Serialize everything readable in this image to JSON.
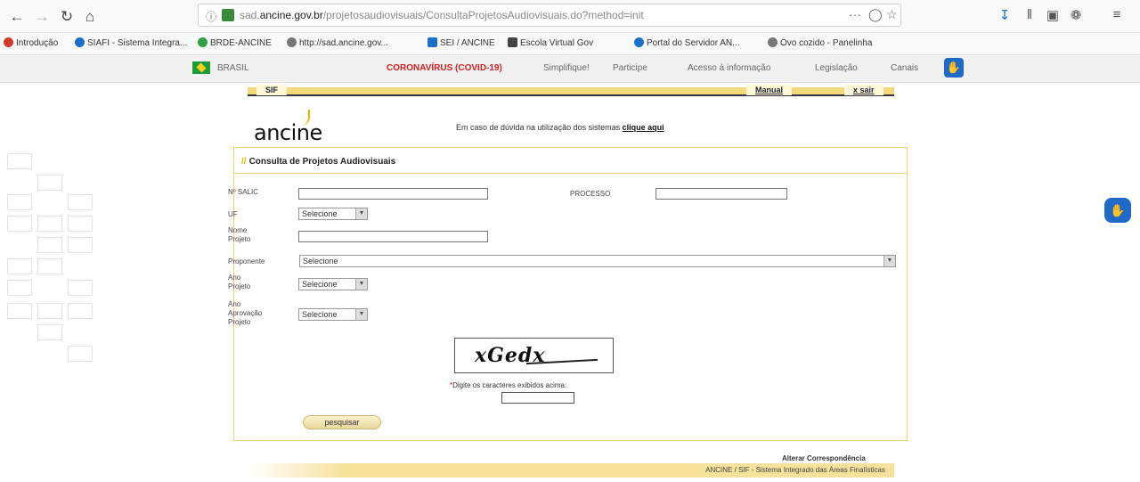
{
  "browser": {
    "url_prefix": "sad.",
    "url_domain": "ancine.gov.br",
    "url_path": "/projetosaudiovisuais/ConsultaProjetosAudiovisuais.do?method=init",
    "more_label": "···"
  },
  "bookmarks": [
    {
      "label": "Introdução",
      "color": "#d13b2f"
    },
    {
      "label": "SIAFI - Sistema Integra...",
      "color": "#1a6fc9"
    },
    {
      "label": "BRDE-ANCINE",
      "color": "#2f9e44"
    },
    {
      "label": "http://sad.ancine.gov...",
      "color": "#777777"
    },
    {
      "label": "SEI / ANCINE",
      "color": "#1a6fc9"
    },
    {
      "label": "Escola Virtual Gov",
      "color": "#444444"
    },
    {
      "label": "Portal do Servidor AN...",
      "color": "#1a6fc9"
    },
    {
      "label": "Ovo cozido - Panelinha",
      "color": "#777777"
    }
  ],
  "govbar": {
    "brasil": "BRASIL",
    "links": [
      "CORONAVÍRUS (COVID-19)",
      "Simplifique!",
      "Participe",
      "Acesso à informação",
      "Legislação",
      "Canais"
    ]
  },
  "header": {
    "sif": "SIF",
    "manual": "Manual",
    "sair": "x sair",
    "logo": "ancine",
    "help_text": "Em caso de dúvida na utilização dos sistemas",
    "help_link": "clique aqui"
  },
  "form": {
    "title": "Consulta de Projetos Audiovisuais",
    "labels": {
      "salic": "Nº SALIC",
      "processo": "PROCESSO",
      "uf": "UF",
      "nome_projeto": "Nome Projeto",
      "proponente": "Proponente",
      "ano_projeto": "Ano Projeto",
      "ano_aprovacao": "Ano Aprovação Projeto"
    },
    "select_default": "Selecione",
    "captcha_text": "xGedx",
    "captcha_instruction": "Digite os caracteres exibidos acima:",
    "captcha_required": "*",
    "submit": "pesquisar"
  },
  "footer": {
    "alterar": "Alterar Correspondência",
    "system": "ANCINE / SIF - Sistema Integrado das Áreas Finalísticas"
  }
}
